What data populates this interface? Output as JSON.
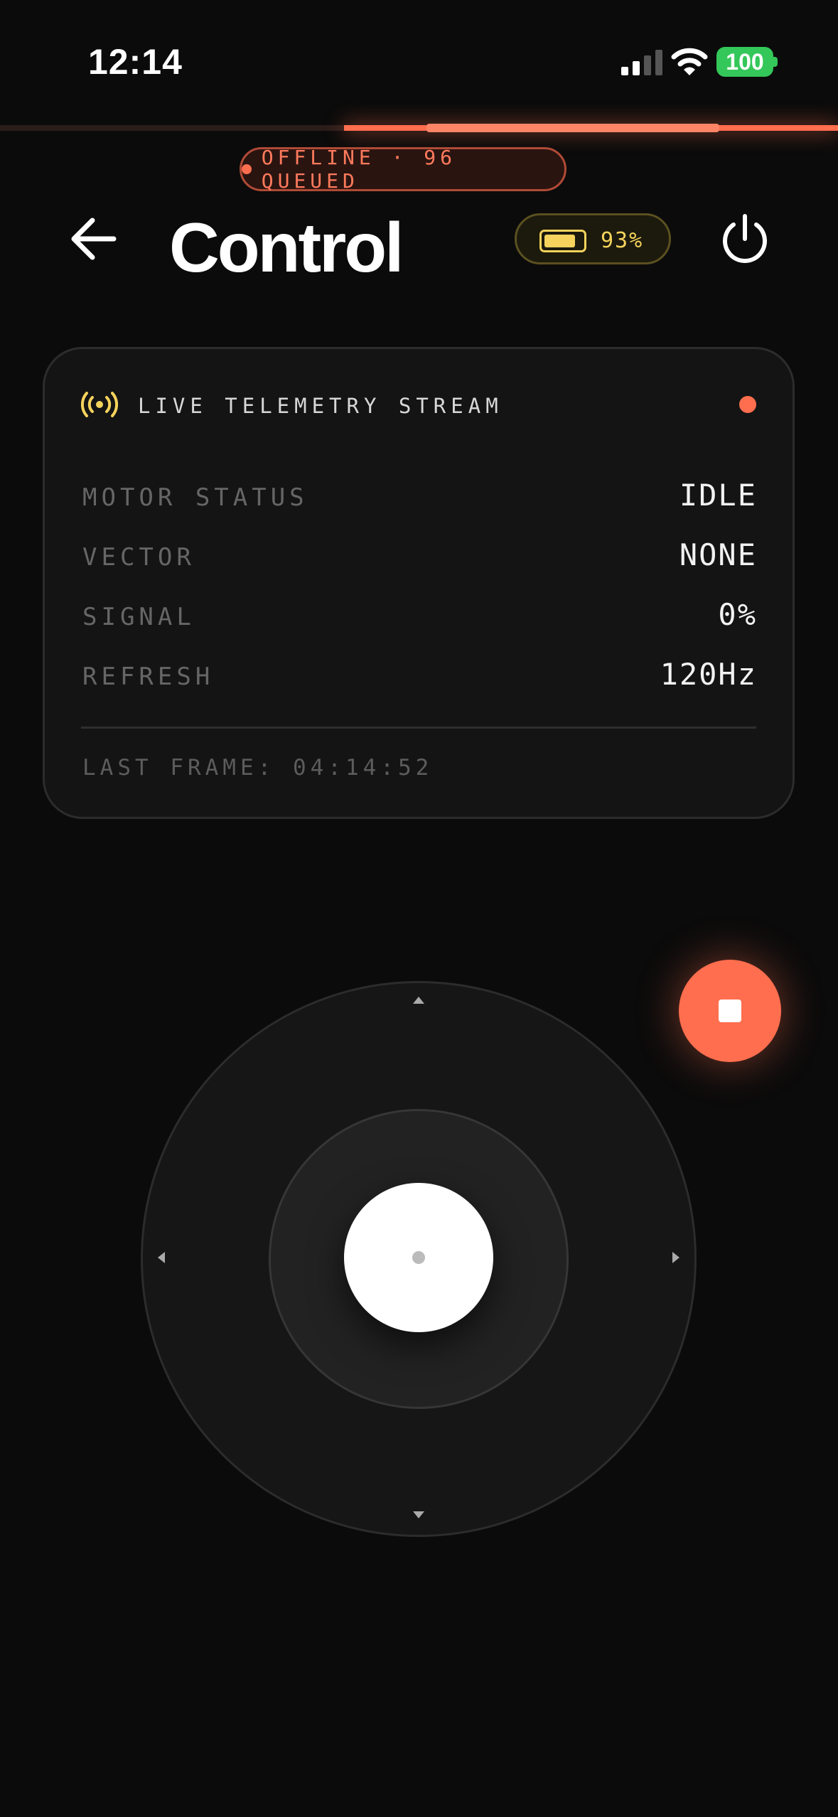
{
  "status_bar": {
    "time": "12:14",
    "battery": "100"
  },
  "banner": {
    "text": "OFFLINE · 96 QUEUED",
    "accent": "#ff6e4e"
  },
  "header": {
    "title": "Control",
    "battery_percent": "93%",
    "battery_level": 0.93
  },
  "telemetry": {
    "title": "LIVE TELEMETRY STREAM",
    "rows": [
      {
        "label": "MOTOR STATUS",
        "value": "IDLE"
      },
      {
        "label": "VECTOR",
        "value": "NONE"
      },
      {
        "label": "SIGNAL",
        "value": "0%"
      },
      {
        "label": "REFRESH",
        "value": "120Hz"
      }
    ],
    "footer": "LAST FRAME: 04:14:52"
  },
  "icons": {
    "back": "arrow-left-icon",
    "power": "power-icon",
    "stream": "broadcast-icon",
    "stop": "stop-icon"
  },
  "colors": {
    "accent": "#ff6e4e",
    "battery": "#f5d35c",
    "status_green": "#34c759"
  }
}
